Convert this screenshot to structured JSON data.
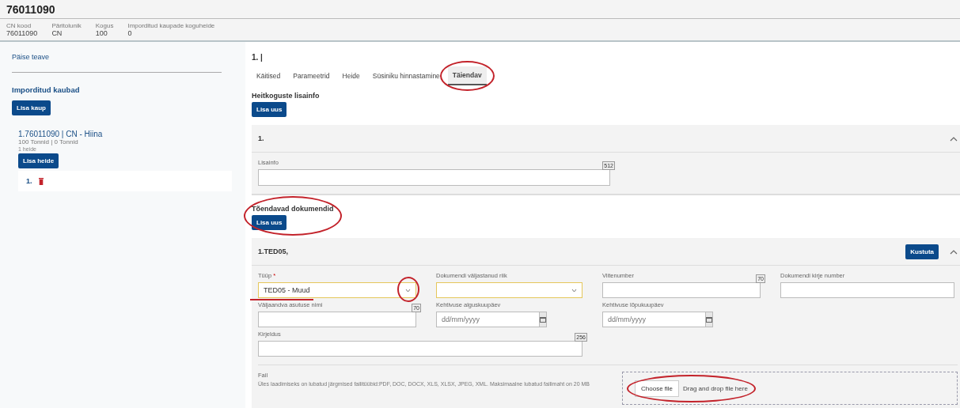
{
  "header": {
    "title": "76011090",
    "facts": [
      {
        "label": "CN kood",
        "value": "76011090"
      },
      {
        "label": "Päritolunik",
        "value": "CN"
      },
      {
        "label": "Kogus",
        "value": "100"
      },
      {
        "label": "Imporditud kaupade koguheide",
        "value": "0"
      }
    ]
  },
  "sidebar": {
    "header_link": "Päise teave",
    "section_title": "Imporditud kaubad",
    "add_button": "Lisa kaup",
    "goods": [
      {
        "title": "1.76011090 | CN - Hiina",
        "amounts": "100 Tonnid | 0 Tonnid",
        "count": "1 heide",
        "add_button": "Lisa heide",
        "emissions": [
          {
            "label": "1."
          }
        ]
      }
    ]
  },
  "main": {
    "title": "1. |",
    "tabs": [
      {
        "label": "Käitised",
        "selected": false,
        "annotated": false
      },
      {
        "label": "Parameetrid",
        "selected": false,
        "annotated": false
      },
      {
        "label": "Heide",
        "selected": false,
        "annotated": false
      },
      {
        "label": "Süsiniku hinnastamine",
        "selected": false,
        "annotated": false
      },
      {
        "label": "Täiendav",
        "selected": true,
        "annotated": true
      }
    ],
    "emission_info": {
      "heading": "Heitkoguste lisainfo",
      "add_button": "Lisa uus",
      "panel": {
        "title": "1.",
        "expanded": true,
        "fields": [
          {
            "kind": "textarea",
            "label": "Lisainfo",
            "limit": "512"
          }
        ]
      }
    },
    "documents": {
      "heading": "Tõendavad dokumendid",
      "annotated": true,
      "add_button": "Lisa uus",
      "panel": {
        "title": "1.TED05,",
        "delete_button": "Kustuta",
        "expanded": true,
        "fields": [
          {
            "kind": "select",
            "label": "Tüüp",
            "required_mark": "*",
            "value": "TED05 - Muud",
            "arrow_annotated": true,
            "underlined": true
          },
          {
            "kind": "select",
            "label": "Dokumendi väljastanud riik"
          },
          {
            "kind": "text",
            "label": "Viitenumber",
            "limit": "70"
          },
          {
            "kind": "text",
            "label": "Dokumendi kirje number"
          },
          {
            "kind": "text",
            "label": "Väljaandva asutuse nimi",
            "limit": "70"
          },
          {
            "kind": "date",
            "label": "Kehtivuse alguskuupäev",
            "placeholder": "dd/mm/yyyy"
          },
          {
            "kind": "date",
            "label": "Kehtivuse lõpukuupäev",
            "placeholder": "dd/mm/yyyy"
          },
          {
            "kind": "break"
          },
          {
            "kind": "wide_text",
            "label": "Kirjeldus",
            "limit": "256"
          }
        ],
        "file": {
          "label": "Fail",
          "hint": "Üles laadimiseks on lubatud järgmised failitüübid:PDF, DOC, DOCX, XLS, XLSX, JPEG, XML. Maksimaalne lubatud failimaht on 20 MB",
          "choose_button": "Choose file",
          "drop_text": "Drag and drop file here",
          "annotated": true
        }
      }
    }
  }
}
